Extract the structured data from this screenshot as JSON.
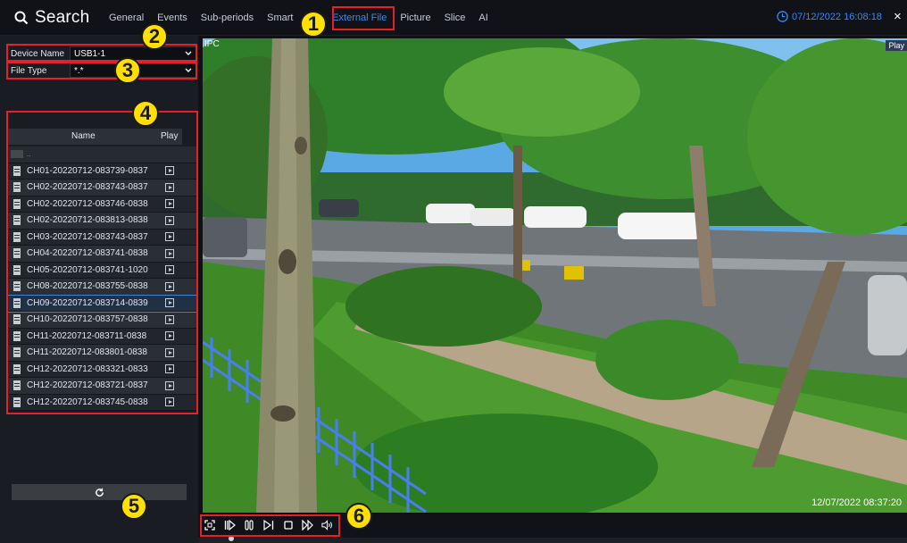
{
  "header": {
    "title": "Search",
    "tabs": [
      "General",
      "Events",
      "Sub-periods",
      "Smart",
      "T",
      "External File",
      "Picture",
      "Slice",
      "AI"
    ],
    "active_tab": "External File",
    "datetime": "07/12/2022 16:08:18",
    "close_label": "×"
  },
  "filters": {
    "device_name_label": "Device Name",
    "device_name_value": "USB1-1",
    "file_type_label": "File Type",
    "file_type_value": "*.*"
  },
  "file_list": {
    "col_name": "Name",
    "col_play": "Play",
    "up_label": "..",
    "files": [
      "CH01-20220712-083739-0837",
      "CH02-20220712-083743-0837",
      "CH02-20220712-083746-0838",
      "CH02-20220712-083813-0838",
      "CH03-20220712-083743-0837",
      "CH04-20220712-083741-0838",
      "CH05-20220712-083741-1020",
      "CH08-20220712-083755-0838",
      "CH09-20220712-083714-0839",
      "CH10-20220712-083757-0838",
      "CH11-20220712-083711-0838",
      "CH11-20220712-083801-0838",
      "CH12-20220712-083321-0833",
      "CH12-20220712-083721-0837",
      "CH12-20220712-083745-0838"
    ],
    "selected_index": 8
  },
  "player": {
    "channel_label": "IPC",
    "play_label": "Play",
    "timestamp": "12/07/2022 08:37:20"
  },
  "controls": {
    "refresh_icon": "refresh-icon",
    "buttons": [
      "fullscreen-icon",
      "step-play-icon",
      "pause-icon",
      "step-frame-icon",
      "stop-icon",
      "fast-forward-icon",
      "volume-icon"
    ]
  },
  "annotations": [
    "1",
    "2",
    "3",
    "4",
    "5",
    "6"
  ],
  "colors": {
    "accent": "#2f8cff",
    "highlight_box": "#e5202a",
    "badge": "#ffe000"
  }
}
